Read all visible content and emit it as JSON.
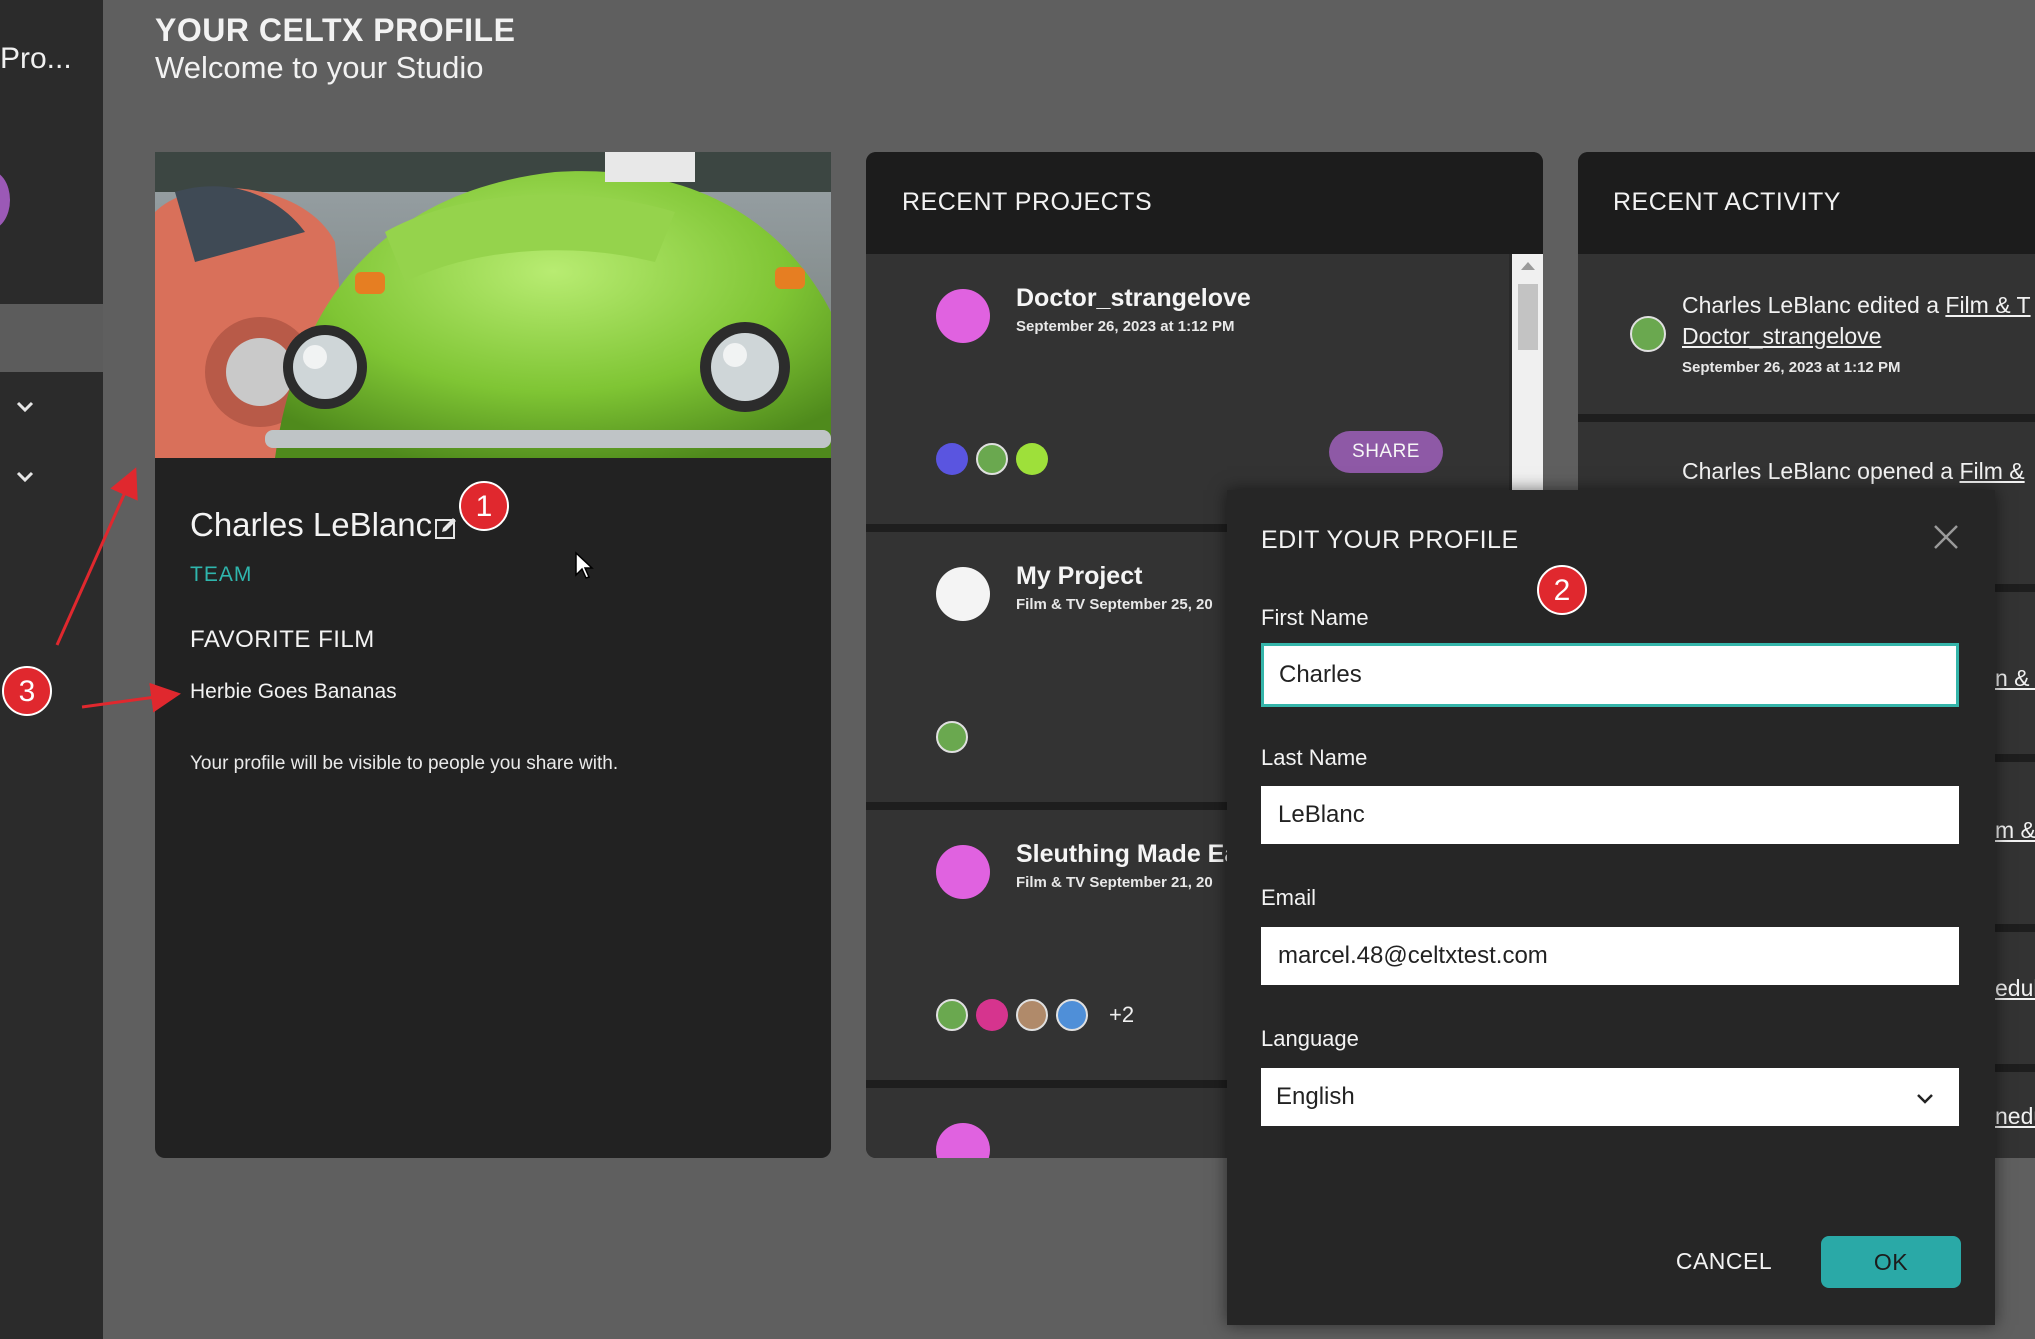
{
  "sidebar": {
    "project_title": "Pro...",
    "avatar_color": "#9b59b6"
  },
  "header": {
    "title": "YOUR CELTX PROFILE",
    "subtitle": "Welcome to your Studio"
  },
  "profile": {
    "name": "Charles LeBlanc",
    "team_label": "TEAM",
    "favorite_film_heading": "FAVORITE FILM",
    "favorite_film": "Herbie Goes Bananas",
    "visibility_note": "Your profile will be visible to people you share with."
  },
  "recent_projects": {
    "title": "RECENT PROJECTS",
    "share_label": "SHARE",
    "items": [
      {
        "name": "Doctor_strangelove",
        "meta": "September 26, 2023 at 1:12 PM",
        "dot_color": "#e062e0"
      },
      {
        "name": "My Project",
        "meta": "Film & TV September 25, 20",
        "dot_color": "#f4f4f4"
      },
      {
        "name": "Sleuthing Made Ea",
        "meta": "Film & TV September 21, 20",
        "dot_color": "#e062e0",
        "extra_collaborators": "+2"
      }
    ]
  },
  "recent_activity": {
    "title": "RECENT ACTIVITY",
    "items": [
      {
        "text": "Charles LeBlanc edited a ",
        "link": "Film & T",
        "link2": "Doctor_strangelove",
        "date": "September 26, 2023 at 1:12 PM"
      },
      {
        "text": "Charles LeBlanc opened a ",
        "link": "Film &"
      }
    ],
    "clipped_links": [
      "n & T",
      "m &",
      "edul",
      "nedu"
    ]
  },
  "modal": {
    "title": "EDIT YOUR PROFILE",
    "first_name_label": "First Name",
    "first_name_value": "Charles",
    "last_name_label": "Last Name",
    "last_name_value": "LeBlanc",
    "email_label": "Email",
    "email_value": "marcel.48@celtxtest.com",
    "language_label": "Language",
    "language_value": "English",
    "cancel_label": "CANCEL",
    "ok_label": "OK"
  },
  "annotations": {
    "badge1": "1",
    "badge2": "2",
    "badge3": "3"
  },
  "colors": {
    "accent_teal": "#2aa9a7",
    "share_purple": "#8e59a6",
    "annotation_red": "#e0282e"
  }
}
